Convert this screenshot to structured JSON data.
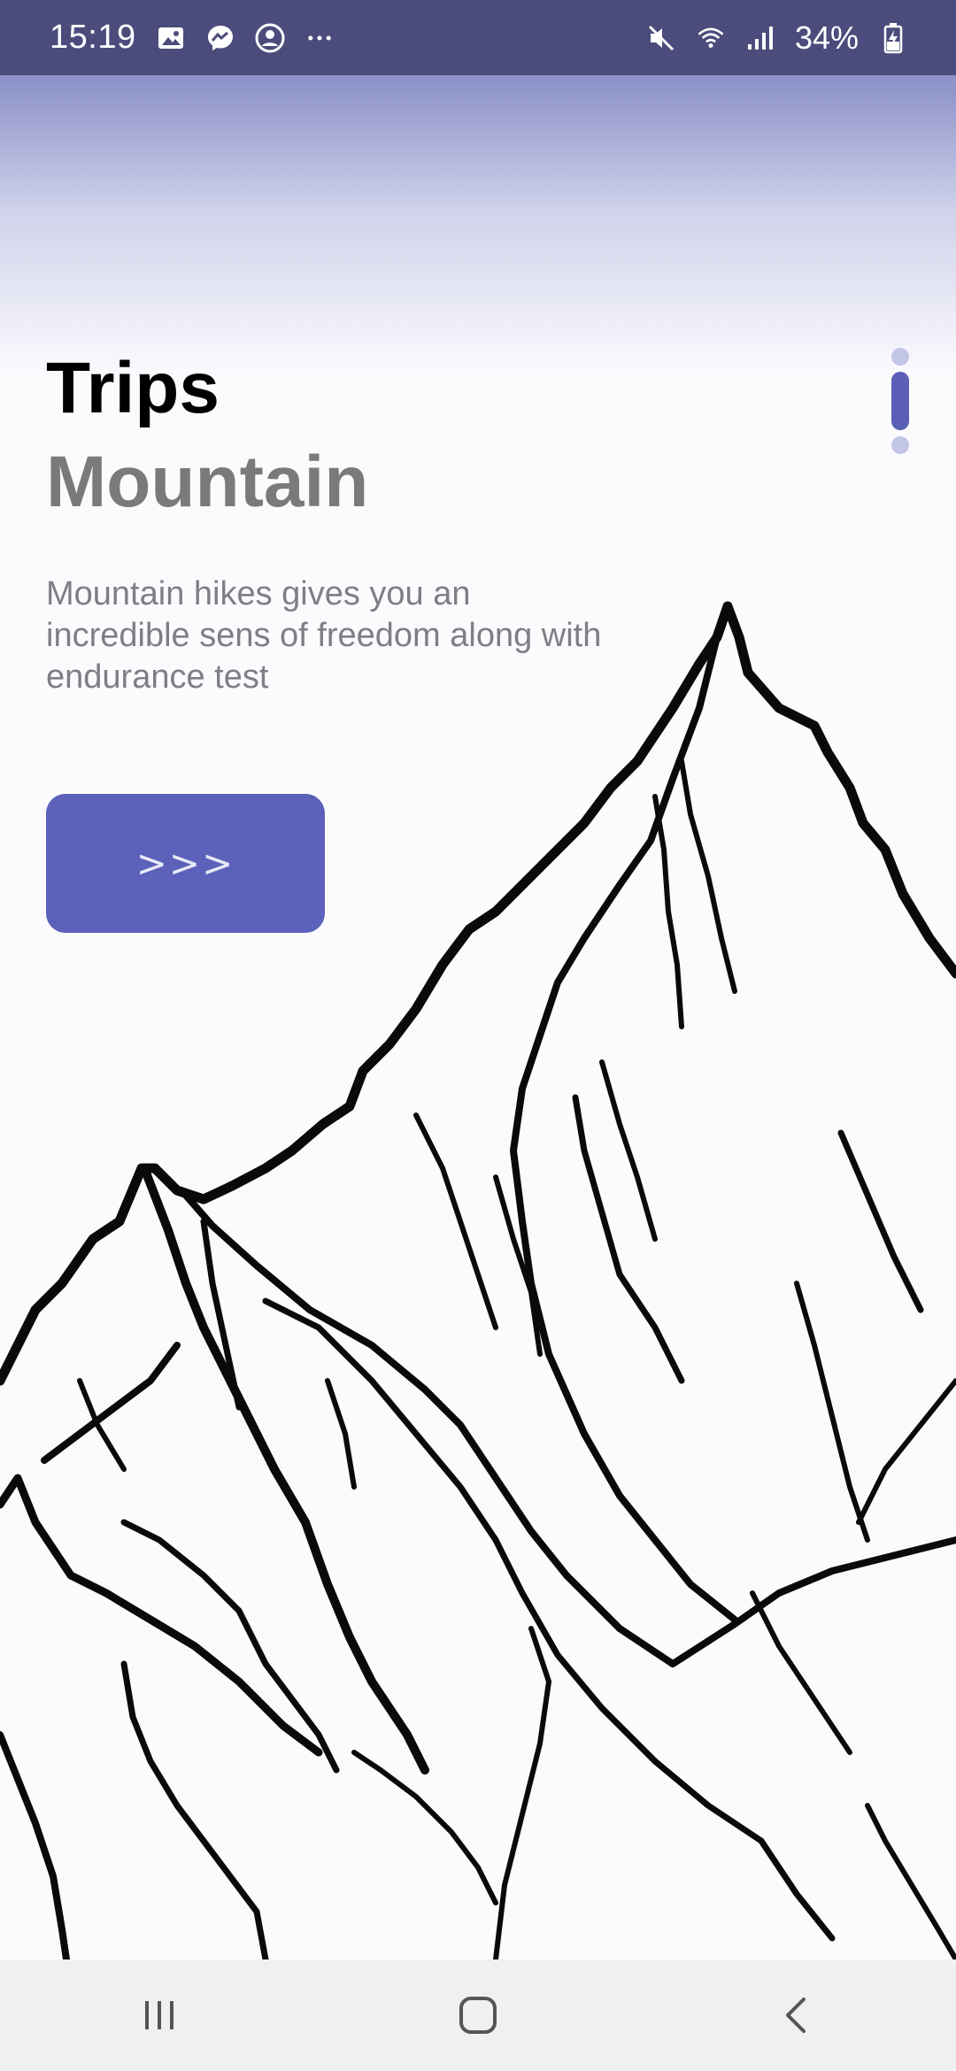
{
  "status_bar": {
    "time": "15:19",
    "battery_percent": "34%",
    "left_icons": [
      "gallery-icon",
      "messenger-icon",
      "account-icon",
      "more-dots-icon"
    ],
    "right_icons": [
      "mute-icon",
      "wifi-icon",
      "signal-icon",
      "battery-charging-icon"
    ]
  },
  "main": {
    "title": "Trips",
    "subtitle": "Mountain",
    "description": "Mountain hikes gives you an incredible sens of freedom along with endurance test",
    "next_button": {
      "label": ">>>",
      "icon": "chevron-arrows-icon"
    }
  },
  "page_indicator": {
    "pages": 3,
    "active_page": 2
  },
  "illustration": {
    "subject": "mountain-sketch"
  },
  "nav_bar": {
    "buttons": [
      "recent-apps-icon",
      "home-icon",
      "back-icon"
    ]
  },
  "colors": {
    "status_bar": "#4b4c7c",
    "accent": "#5c61b9",
    "indicator_inactive": "#c3c5e6",
    "subtitle": "#7a7a7a",
    "description": "#7e7e86"
  }
}
